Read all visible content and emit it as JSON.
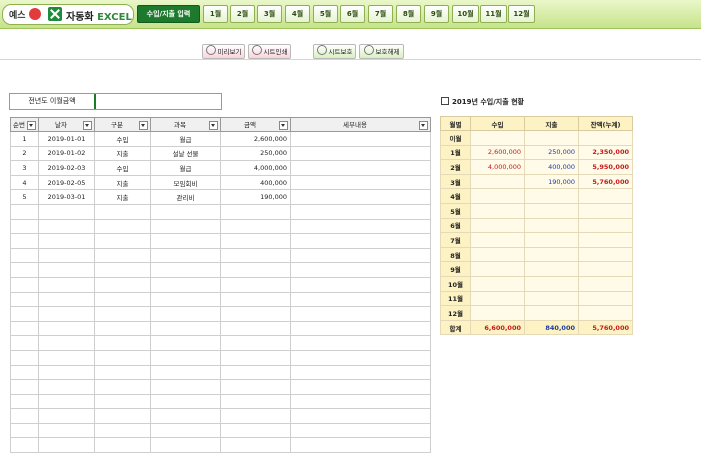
{
  "app": {
    "logo_left": "예스",
    "logo_main": "자동화",
    "logo_excel": "EXCEL"
  },
  "tabs": [
    {
      "label": "수입/지출 입력",
      "active": true
    },
    {
      "label": "1월"
    },
    {
      "label": "2월"
    },
    {
      "label": "3월"
    },
    {
      "label": "4월"
    },
    {
      "label": "5월"
    },
    {
      "label": "6월"
    },
    {
      "label": "7월"
    },
    {
      "label": "8월"
    },
    {
      "label": "9월"
    },
    {
      "label": "10월"
    },
    {
      "label": "11월"
    },
    {
      "label": "12월"
    }
  ],
  "toolbar": {
    "preview": "미리보기",
    "print": "시트인쇄",
    "protect": "시트보호",
    "unprotect": "보호해제"
  },
  "prev_year_label": "전년도 이월금액",
  "ledger": {
    "headers": [
      "순번",
      "날자",
      "구분",
      "과목",
      "금액",
      "세부내용"
    ],
    "rows": [
      [
        "1",
        "2019-01-01",
        "수입",
        "월급",
        "2,600,000",
        ""
      ],
      [
        "2",
        "2019-01-02",
        "지출",
        "설날 선물",
        "250,000",
        ""
      ],
      [
        "3",
        "2019-02-03",
        "수입",
        "월급",
        "4,000,000",
        ""
      ],
      [
        "4",
        "2019-02-05",
        "지출",
        "모임회비",
        "400,000",
        ""
      ],
      [
        "5",
        "2019-03-01",
        "지출",
        "관리비",
        "190,000",
        ""
      ]
    ]
  },
  "summary": {
    "title": "2019년 수입/지출 현황",
    "headers": [
      "월별",
      "수입",
      "지출",
      "잔액(누계)"
    ],
    "rows": [
      [
        "이월",
        "",
        "",
        ""
      ],
      [
        "1월",
        "2,600,000",
        "250,000",
        "2,350,000"
      ],
      [
        "2월",
        "4,000,000",
        "400,000",
        "5,950,000"
      ],
      [
        "3월",
        "",
        "190,000",
        "5,760,000"
      ],
      [
        "4월",
        "",
        "",
        ""
      ],
      [
        "5월",
        "",
        "",
        ""
      ],
      [
        "6월",
        "",
        "",
        ""
      ],
      [
        "7월",
        "",
        "",
        ""
      ],
      [
        "8월",
        "",
        "",
        ""
      ],
      [
        "9월",
        "",
        "",
        ""
      ],
      [
        "10월",
        "",
        "",
        ""
      ],
      [
        "11월",
        "",
        "",
        ""
      ],
      [
        "12월",
        "",
        "",
        ""
      ]
    ],
    "total": [
      "합계",
      "6,600,000",
      "840,000",
      "5,760,000"
    ]
  }
}
